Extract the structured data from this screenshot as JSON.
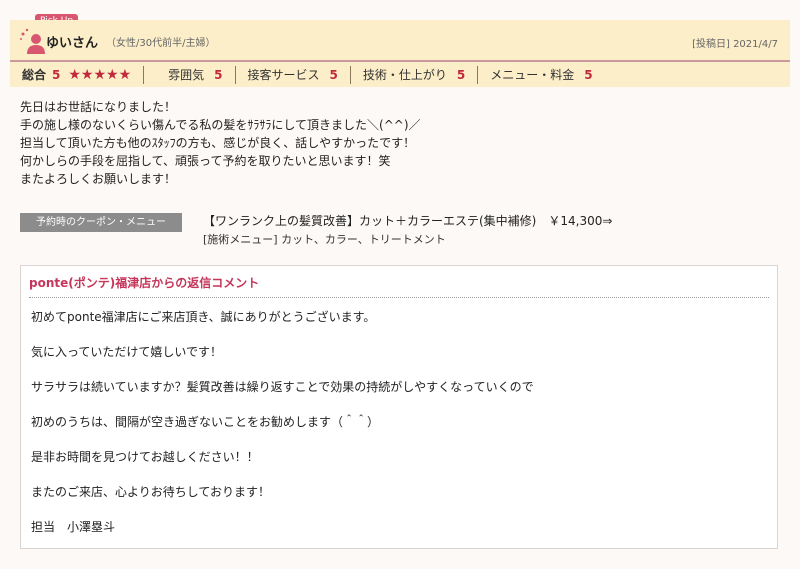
{
  "header": {
    "pickup_label": "Pick Up",
    "username": "ゆいさん",
    "user_attributes": "（女性/30代前半/主婦）",
    "post_date": "[投稿日] 2021/4/7"
  },
  "ratings": {
    "total_label": "総合",
    "total_value": "5",
    "stars": "★★★★★",
    "items": [
      {
        "label": "雰囲気",
        "value": "5"
      },
      {
        "label": "接客サービス",
        "value": "5"
      },
      {
        "label": "技術・仕上がり",
        "value": "5"
      },
      {
        "label": "メニュー・料金",
        "value": "5"
      }
    ]
  },
  "review_lines": [
    "先日はお世話になりました！",
    "手の施し様のないくらい傷んでる私の髪をｻﾗｻﾗにして頂きました＼(^^)／",
    "担当して頂いた方も他のｽﾀｯﾌの方も、感じが良く、話しやすかったです！",
    "何かしらの手段を屈指して、頑張って予約を取りたいと思います！笑",
    "またよろしくお願いします！"
  ],
  "coupon": {
    "tag": "予約時のクーポン・メニュー",
    "name": "【ワンランク上の髪質改善】カット＋カラーエステ(集中補修)　￥14,300⇒",
    "menu": "[施術メニュー] カット、カラー、トリートメント"
  },
  "reply": {
    "title": "ponte(ポンテ)福津店からの返信コメント",
    "lines": [
      "初めてponte福津店にご来店頂き、誠にありがとうございます。",
      "気に入っていただけて嬉しいです！",
      "サラサラは続いていますか？髪質改善は繰り返すことで効果の持続がしやすくなっていくので",
      "初めのうちは、間隔が空き過ぎないことをお勧めします（＾＾）",
      "是非お時間を見つけてお越しください！！",
      "またのご来店、心よりお待ちしております！",
      "担当　小澤塁斗"
    ]
  },
  "colors": {
    "accent": "#c1293d",
    "header_bg": "#fbeec8",
    "pickup": "#d8566f"
  },
  "icons": {
    "avatar": "user-avatar-icon"
  }
}
